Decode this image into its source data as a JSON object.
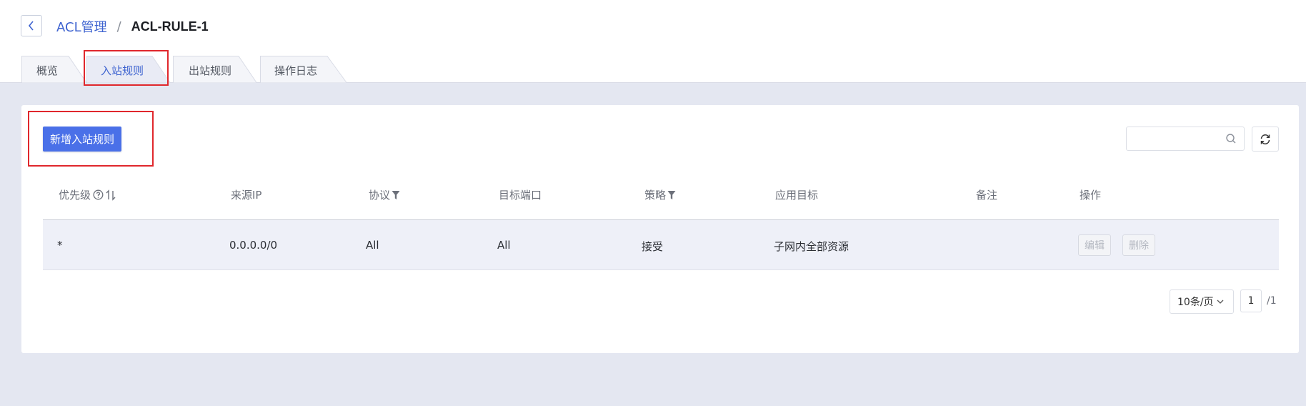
{
  "breadcrumb": {
    "parent": "ACL管理",
    "separator": "/",
    "current": "ACL-RULE-1"
  },
  "tabs": [
    {
      "label": "概览",
      "active": false
    },
    {
      "label": "入站规则",
      "active": true
    },
    {
      "label": "出站规则",
      "active": false
    },
    {
      "label": "操作日志",
      "active": false
    }
  ],
  "toolbar": {
    "add_label": "新增入站规则",
    "search_placeholder": "",
    "search_icon": "search-icon",
    "refresh_icon": "refresh-icon"
  },
  "table": {
    "columns": [
      "优先级",
      "来源IP",
      "协议",
      "目标端口",
      "策略",
      "应用目标",
      "备注",
      "操作"
    ],
    "rows": [
      {
        "priority": "*",
        "source_ip": "0.0.0.0/0",
        "protocol": "All",
        "target_port": "All",
        "policy": "接受",
        "apply_target": "子网内全部资源",
        "remark": "",
        "actions": [
          "编辑",
          "删除"
        ]
      }
    ]
  },
  "pagination": {
    "page_size": "10条/页",
    "current_page": "1",
    "total": "/1"
  },
  "colors": {
    "accent": "#4a70e8",
    "link": "#3e63d0",
    "highlight": "#e0272c"
  }
}
